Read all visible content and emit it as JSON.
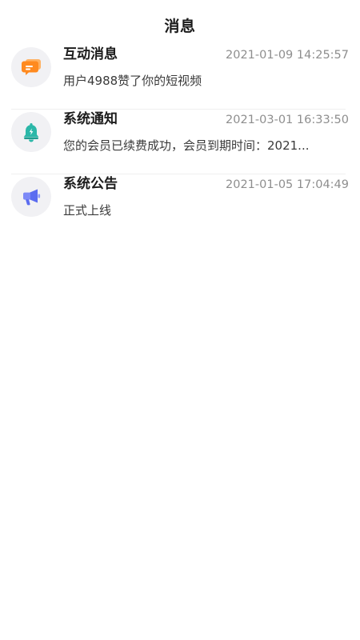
{
  "header": {
    "title": "消息"
  },
  "colors": {
    "interactive_icon": "#FF8A1F",
    "notice_icon": "#2BB7A8",
    "announce_icon": "#5B6CF0",
    "avatar_bg": "#F1F1F4",
    "time_text": "#8E8E8E"
  },
  "messages": [
    {
      "icon": "chat-bubble-icon",
      "title": "互动消息",
      "time": "2021-01-09 14:25:57",
      "preview": "用户4988赞了你的短视频"
    },
    {
      "icon": "bell-icon",
      "title": "系统通知",
      "time": "2021-03-01 16:33:50",
      "preview": "您的会员已续费成功，会员到期时间：2021..."
    },
    {
      "icon": "megaphone-icon",
      "title": "系统公告",
      "time": "2021-01-05 17:04:49",
      "preview": "正式上线"
    }
  ]
}
